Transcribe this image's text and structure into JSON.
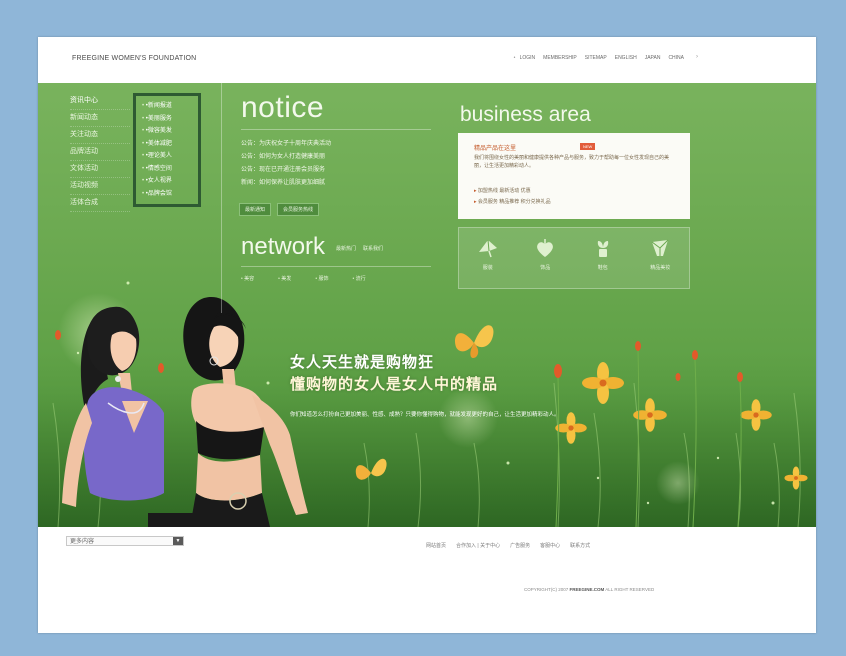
{
  "header": {
    "brand": "FREEGINE WOMEN'S FOUNDATION",
    "nav": [
      "LOGIN",
      "MEMBERSHIP",
      "SITEMAP",
      "ENGLISH",
      "JAPAN",
      "CHINA"
    ]
  },
  "left_nav": {
    "items": [
      "资讯中心",
      "新闻动态",
      "关注动态",
      "品牌活动",
      "文体活动",
      "活动视频",
      "活体合成"
    ]
  },
  "submenu": {
    "items": [
      "•新闻报道",
      "•美丽服务",
      "•微容美发",
      "•美体减肥",
      "•理论美人",
      "•情感空间",
      "•女人视界",
      "•品牌会馆"
    ]
  },
  "notice": {
    "title": "notice",
    "items": [
      "公告：为庆祝女子十周年庆典活动",
      "公告：如何为女人打造健康美丽",
      "公告：现在已开通注册会员服务",
      "新闻：如何保养让肌肤更加细腻"
    ],
    "buttons": [
      "最新通知",
      "会员服务热线"
    ]
  },
  "network": {
    "title": "network",
    "links": [
      "最新热门",
      "联系我们"
    ],
    "items": [
      "美容",
      "美发",
      "服饰",
      "流行"
    ]
  },
  "business": {
    "title": "business area",
    "card_title": "精品产品在这里",
    "badge": "NEW",
    "desc": "我们将围绕女性的美丽和健康提供各种产品与服务，致力于帮助每一位女性发现自己的美丽，让生活更加精彩动人。",
    "line1": "加盟热线   最新活动   优惠",
    "line2": "会员服务  精品推荐  积分兑换礼品",
    "icons": [
      {
        "icon": "fan-icon",
        "label": "服装"
      },
      {
        "icon": "heart-icon",
        "label": "饰品"
      },
      {
        "icon": "leaf-icon",
        "label": "鞋包"
      },
      {
        "icon": "crystal-icon",
        "label": "精品美妆"
      }
    ]
  },
  "hero": {
    "line1": "女人天生就是购物狂",
    "line2": "懂购物的女人是女人中的精品",
    "line3": "你们知道怎么打扮自己更加美丽、性感、成熟？只要你懂得购物，就能发现更好的自己，让生活更加精彩动人。"
  },
  "footer": {
    "select_label": "更多内容",
    "links": [
      "网站首页",
      "合作加入 | 关于中心",
      "广告服务",
      "客服中心",
      "联系方式"
    ],
    "copyright_pre": "COPYRIGHT(C) 2007 ",
    "copyright_brand": "FREEGINE.COM",
    "copyright_post": " ALL RIGHT RESERVED"
  }
}
